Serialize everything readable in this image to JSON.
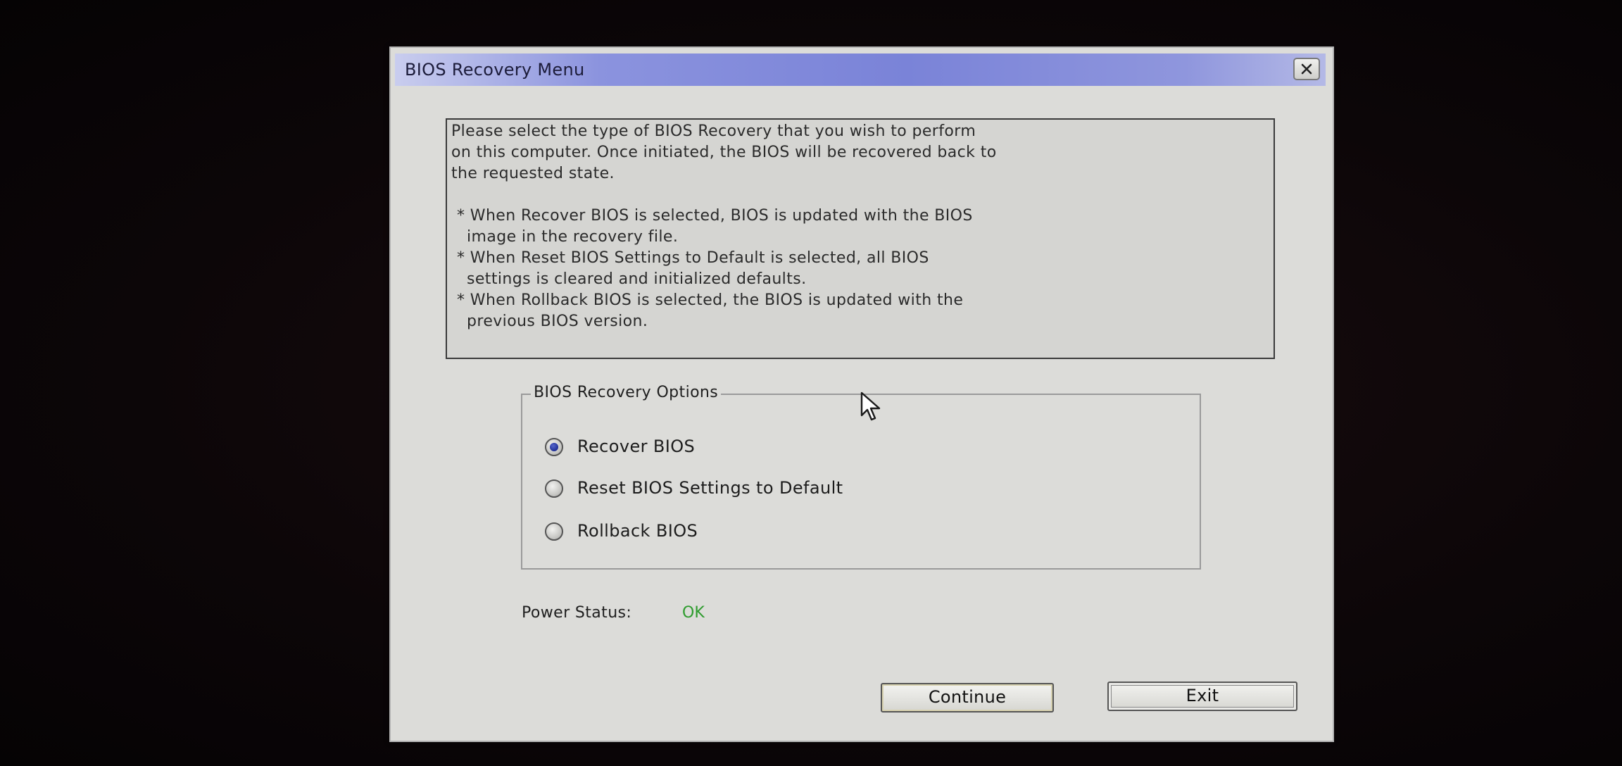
{
  "window": {
    "title": "BIOS Recovery Menu",
    "close_icon": "close-x-icon"
  },
  "info": {
    "lines": [
      "Please select the type of BIOS Recovery that you wish to perform",
      "on this computer. Once initiated, the BIOS will be recovered back to",
      "the requested state.",
      "* When Recover BIOS is selected, BIOS is updated with the BIOS",
      "image in the recovery file.",
      "* When Reset BIOS Settings to Default is selected, all BIOS",
      "settings is cleared and initialized defaults.",
      "* When Rollback BIOS is selected, the BIOS is updated with the",
      "previous BIOS version."
    ]
  },
  "options": {
    "legend": "BIOS Recovery Options",
    "items": [
      {
        "label": "Recover BIOS",
        "selected": true
      },
      {
        "label": "Reset BIOS Settings to Default",
        "selected": false
      },
      {
        "label": "Rollback BIOS",
        "selected": false
      }
    ]
  },
  "power": {
    "label": "Power Status:",
    "value": "OK",
    "value_color": "#2e9c2e"
  },
  "buttons": {
    "continue": "Continue",
    "exit": "Exit"
  },
  "colors": {
    "titlebar_accent": "#7a83d8",
    "window_bg": "#dcdcd9",
    "radio_selected": "#1f2f96"
  }
}
